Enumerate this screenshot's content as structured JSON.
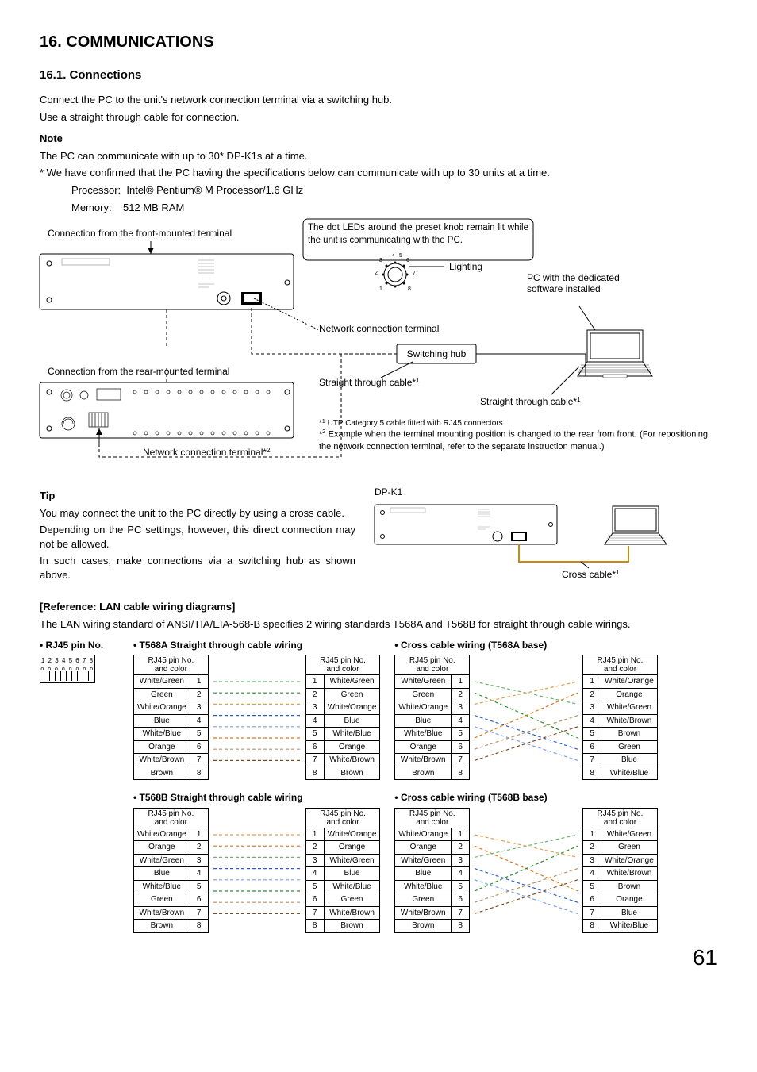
{
  "page_number": "61",
  "h1": "16. COMMUNICATIONS",
  "h2": "16.1. Connections",
  "intro1": "Connect the PC to the unit's network connection terminal via a switching hub.",
  "intro2": "Use a straight through cable for connection.",
  "note_label": "Note",
  "note_line1": "The PC can communicate with up to 30* DP-K1s at a time.",
  "note_line2": "* We have confirmed that the PC having the specifications below can communicate with up to 30 units at a time.",
  "spec_cpu_label": "Processor:",
  "spec_cpu_value": "Intel® Pentium® M Processor/1.6 GHz",
  "spec_mem_label": "Memory:",
  "spec_mem_value": "512 MB RAM",
  "diag": {
    "front_label": "Connection from the front-mounted terminal",
    "rear_label": "Connection from the rear-mounted terminal",
    "led_text": "The dot LEDs around the preset knob remain lit while the unit is communicating with the PC.",
    "lighting": "Lighting",
    "pc_text": "PC with the dedicated software installed",
    "net_term": "Network connection terminal",
    "switch_hub": "Switching hub",
    "straight1": "Straight through cable*",
    "straight1_sup": "1",
    "straight2": "Straight through cable*",
    "straight2_sup": "1",
    "net_term2": "Network connection terminal*",
    "net_term2_sup": "2",
    "foot1_pre": "*",
    "foot1_sup": "1",
    "foot1": "UTP Category 5 cable fitted with RJ45 connectors",
    "foot2_pre": "*",
    "foot2_sup": "2",
    "foot2": "Example when the terminal mounting position is changed to the rear from front. (For repositioning the network connection terminal, refer to the separate instruction manual.)"
  },
  "tip_label": "Tip",
  "tip1": "You may connect the unit to the PC directly by using a cross cable.",
  "tip2": "Depending on the PC settings, however, this direct connection may not be allowed.",
  "tip3": "In such cases, make connections via a switching hub as shown above.",
  "dpk1": "DP-K1",
  "cross_cable": "Cross cable*",
  "cross_cable_sup": "1",
  "ref_heading": "[Reference: LAN cable wiring diagrams]",
  "ref_text": "The LAN wiring standard of ANSI/TIA/EIA-568-B specifies 2 wiring standards T568A and T568B for straight through cable wirings.",
  "rj45_title": "• RJ45 pin No.",
  "rj45_digits": "1 2 3 4 5 6 7 8",
  "t568a_title": "• T568A Straight through cable wiring",
  "t568b_title": "• T568B Straight through cable wiring",
  "crossA_title": "• Cross cable wiring (T568A base)",
  "crossB_title": "• Cross cable wiring (T568B base)",
  "hdr_pin_color": "RJ45 pin No. and color",
  "t568a": [
    "White/Green",
    "Green",
    "White/Orange",
    "Blue",
    "White/Blue",
    "Orange",
    "White/Brown",
    "Brown"
  ],
  "t568b": [
    "White/Orange",
    "Orange",
    "White/Green",
    "Blue",
    "White/Blue",
    "Green",
    "White/Brown",
    "Brown"
  ],
  "crossA_right": [
    "White/Orange",
    "Orange",
    "White/Green",
    "White/Brown",
    "Brown",
    "Green",
    "Blue",
    "White/Blue"
  ],
  "crossB_right": [
    "White/Green",
    "Green",
    "White/Orange",
    "White/Brown",
    "Brown",
    "Orange",
    "Blue",
    "White/Blue"
  ],
  "pins": [
    "1",
    "2",
    "3",
    "4",
    "5",
    "6",
    "7",
    "8"
  ]
}
